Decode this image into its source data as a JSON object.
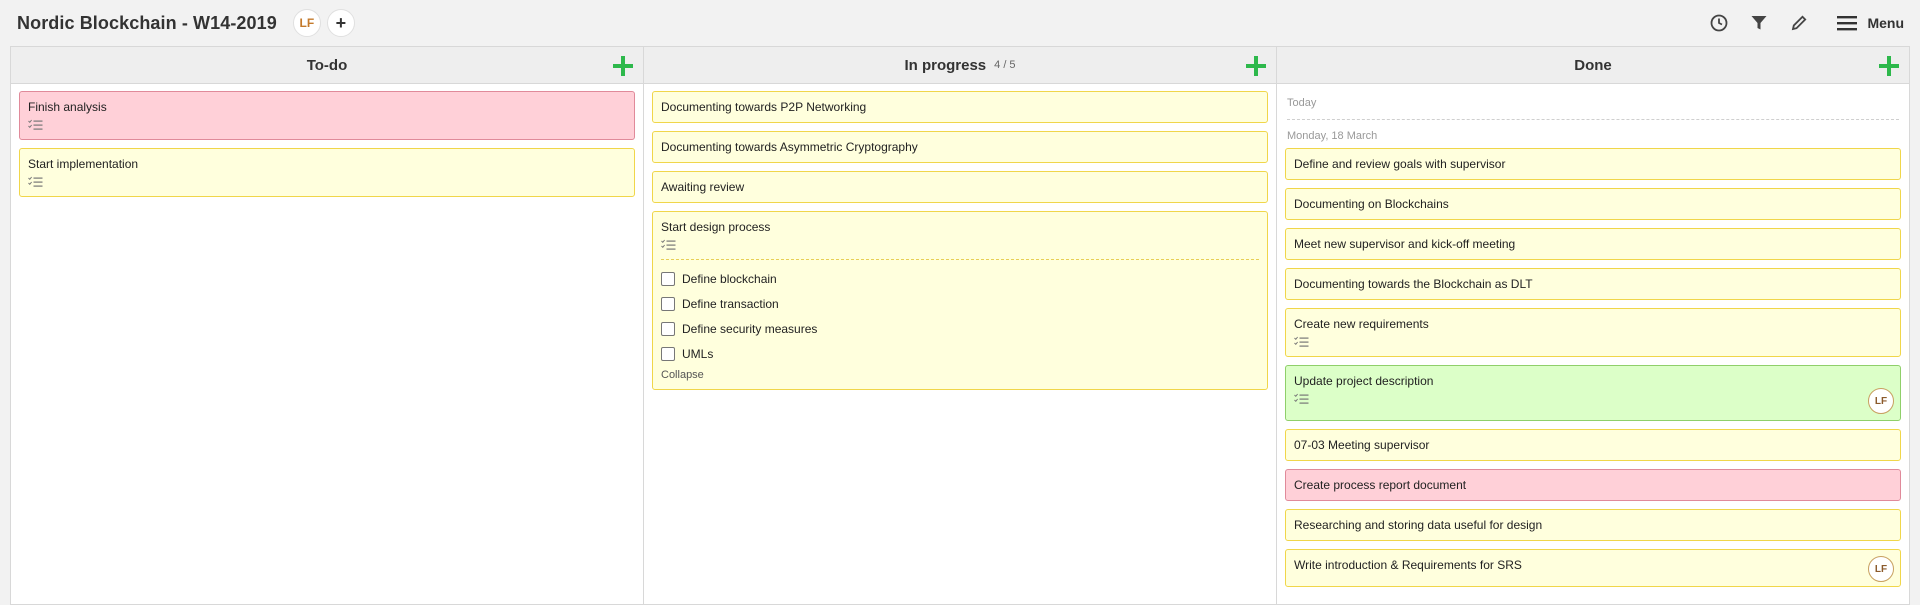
{
  "header": {
    "title": "Nordic Blockchain - W14-2019",
    "user_initials": "LF",
    "add_member": "+",
    "menu_label": "Menu"
  },
  "icons": {
    "history": "clock-icon",
    "filter": "filter-icon",
    "edit": "pencil-icon",
    "menu": "hamburger-icon",
    "checklist": "checklist-icon",
    "add": "plus-icon"
  },
  "colors": {
    "add": "#2db84b",
    "card_yellow": "#ffffdd",
    "card_red": "#ffd0d8",
    "card_green": "#dcffc8"
  },
  "columns": {
    "todo": {
      "title": "To-do",
      "cards": [
        {
          "title": "Finish analysis",
          "color": "red",
          "has_checklist": true
        },
        {
          "title": "Start implementation",
          "color": "yellow",
          "has_checklist": true
        }
      ]
    },
    "progress": {
      "title": "In progress",
      "count": "4 / 5",
      "cards": [
        {
          "title": "Documenting towards P2P Networking"
        },
        {
          "title": "Documenting towards Asymmetric Cryptography"
        },
        {
          "title": "Awaiting review"
        },
        {
          "title": "Start design process",
          "checklist": [
            "Define blockchain",
            "Define transaction",
            "Define security measures",
            "UMLs"
          ],
          "collapse_label": "Collapse"
        }
      ]
    },
    "done": {
      "title": "Done",
      "group_today": "Today",
      "group_date": "Monday, 18 March",
      "cards": [
        {
          "title": "Define and review goals with supervisor"
        },
        {
          "title": "Documenting on Blockchains"
        },
        {
          "title": "Meet new supervisor and kick-off meeting"
        },
        {
          "title": "Documenting towards the Blockchain as DLT"
        },
        {
          "title": "Create new requirements",
          "has_checklist": true
        },
        {
          "title": "Update project description",
          "has_checklist": true,
          "color": "green",
          "avatar": "LF"
        },
        {
          "title": "07-03 Meeting supervisor"
        },
        {
          "title": "Create process report document",
          "color": "red"
        },
        {
          "title": "Researching and storing data useful for design"
        },
        {
          "title": "Write introduction & Requirements for SRS",
          "avatar": "LF"
        }
      ]
    }
  }
}
